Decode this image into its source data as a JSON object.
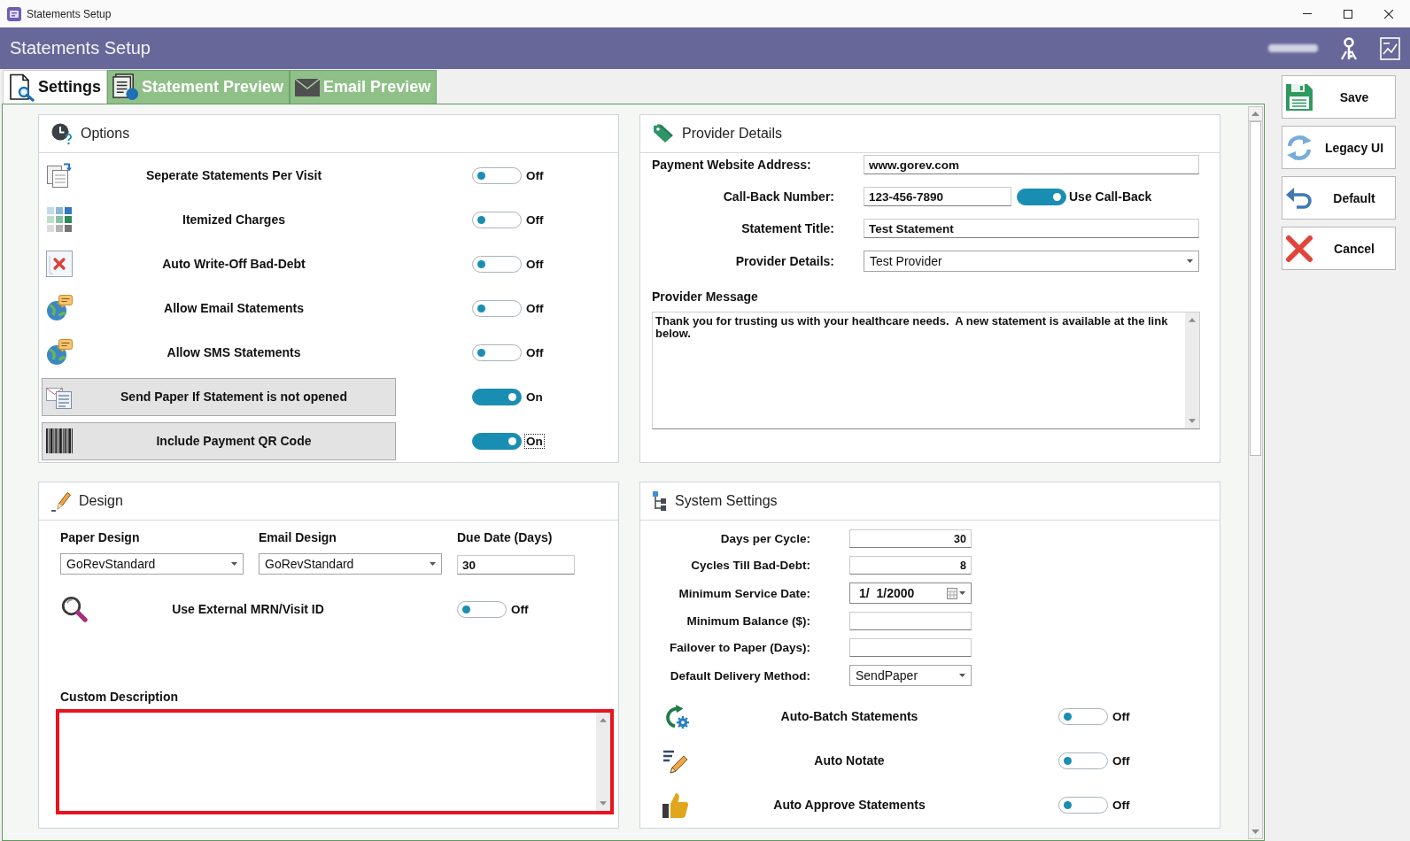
{
  "window": {
    "title": "Statements Setup"
  },
  "header": {
    "title": "Statements Setup"
  },
  "tabs": [
    {
      "label": "Settings",
      "selected": true
    },
    {
      "label": "Statement Preview",
      "selected": false
    },
    {
      "label": "Email Preview",
      "selected": false
    }
  ],
  "options": {
    "title": "Options",
    "items": [
      {
        "label": "Seperate Statements Per Visit",
        "on": false,
        "status": "Off",
        "highlighted": false,
        "focused": false
      },
      {
        "label": "Itemized Charges",
        "on": false,
        "status": "Off",
        "highlighted": false,
        "focused": false
      },
      {
        "label": "Auto Write-Off Bad-Debt",
        "on": false,
        "status": "Off",
        "highlighted": false,
        "focused": false
      },
      {
        "label": "Allow Email Statements",
        "on": false,
        "status": "Off",
        "highlighted": false,
        "focused": false
      },
      {
        "label": "Allow SMS Statements",
        "on": false,
        "status": "Off",
        "highlighted": false,
        "focused": false
      },
      {
        "label": "Send Paper If Statement is not opened",
        "on": true,
        "status": "On",
        "highlighted": true,
        "focused": false
      },
      {
        "label": "Include Payment QR Code",
        "on": true,
        "status": "On",
        "highlighted": true,
        "focused": true
      }
    ]
  },
  "provider_details": {
    "title": "Provider Details",
    "fields": [
      {
        "label": "Payment Website Address:",
        "kind": "text",
        "value": "www.gorev.com"
      },
      {
        "label": "Call-Back Number:",
        "kind": "text",
        "value": "123-456-7890",
        "toggle": {
          "label": "Use Call-Back",
          "on": true
        }
      },
      {
        "label": "Statement Title:",
        "kind": "text",
        "value": "Test Statement"
      },
      {
        "label": "Provider Details:",
        "kind": "select",
        "value": "Test Provider"
      }
    ],
    "message": {
      "label": "Provider Message",
      "value": "Thank you for trusting us with your healthcare needs.  A new statement is available at the link below."
    }
  },
  "design": {
    "title": "Design",
    "fields": [
      {
        "label": "Paper Design",
        "kind": "select",
        "value": "GoRevStandard"
      },
      {
        "label": "Email Design",
        "kind": "select",
        "value": "GoRevStandard"
      },
      {
        "label": "Due Date (Days)",
        "kind": "text",
        "value": "30"
      }
    ],
    "items": [
      {
        "label": "Use External MRN/Visit ID",
        "on": false,
        "status": "Off"
      }
    ],
    "description": {
      "label": "Custom Description",
      "highlighted": true
    }
  },
  "system_settings": {
    "title": "System Settings",
    "fields": [
      {
        "label": "Days per Cycle:",
        "kind": "number",
        "value": "30"
      },
      {
        "label": "Cycles Till Bad-Debt:",
        "kind": "number",
        "value": "8"
      },
      {
        "label": "Minimum Service Date:",
        "kind": "date",
        "value": "1/  1/2000"
      },
      {
        "label": "Minimum Balance ($):",
        "kind": "number"
      },
      {
        "label": "Failover to Paper (Days):",
        "kind": "number"
      },
      {
        "label": "Default Delivery Method:",
        "kind": "select",
        "value": "SendPaper"
      }
    ],
    "items": [
      {
        "label": "Auto-Batch Statements",
        "on": false,
        "status": "Off"
      },
      {
        "label": "Auto Notate",
        "on": false,
        "status": "Off"
      },
      {
        "label": "Auto Approve Statements",
        "on": false,
        "status": "Off"
      }
    ]
  },
  "actions": [
    {
      "label": "Save"
    },
    {
      "label": "Legacy UI"
    },
    {
      "label": "Default"
    },
    {
      "label": "Cancel"
    }
  ]
}
